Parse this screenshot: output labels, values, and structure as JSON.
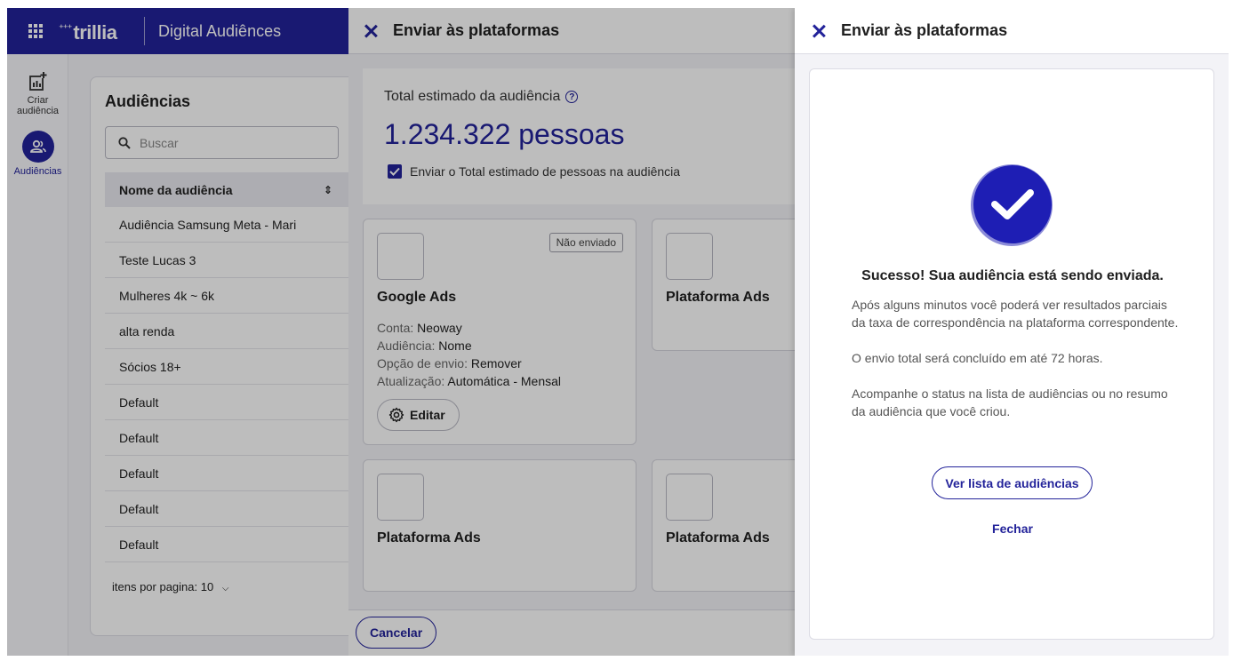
{
  "app": {
    "product_name": "Digital Audiênces",
    "brand_name": "trillia",
    "colors": {
      "brand": "#23239a",
      "background": "#f3f3f7"
    }
  },
  "nav": {
    "create": {
      "label_line1": "Criar",
      "label_line2": "audiência",
      "icon": "add-chart-icon"
    },
    "audiences": {
      "label": "Audiências",
      "icon": "group-icon"
    }
  },
  "audiences": {
    "title": "Audiências",
    "search_placeholder": "Buscar",
    "column_header": "Nome da audiência",
    "rows": [
      "Audiência Samsung Meta - Mari",
      "Teste Lucas 3",
      "Mulheres 4k ~ 6k",
      "alta renda",
      "Sócios 18+",
      "Default",
      "Default",
      "Default",
      "Default",
      "Default"
    ],
    "pager_label": "itens por pagina: 10"
  },
  "send_panel": {
    "title": "Enviar às plataformas",
    "total_label": "Total estimado da audiência",
    "total_value": "1.234.322 pessoas",
    "checkbox_label": "Enviar o Total estimado de pessoas na audiência",
    "platforms": [
      {
        "name": "Google Ads",
        "badge": "Não enviado",
        "fields": [
          {
            "label": "Conta:",
            "value": "Neoway"
          },
          {
            "label": "Audiência:",
            "value": "Nome"
          },
          {
            "label": "Opção de envio:",
            "value": "Remover"
          },
          {
            "label": "Atualização:",
            "value": "Automática - Mensal"
          }
        ],
        "edit_label": "Editar"
      },
      {
        "name": "Plataforma Ads"
      },
      {
        "name": "Plataforma Ads"
      },
      {
        "name": "Plataforma Ads"
      }
    ],
    "cancel_label": "Cancelar"
  },
  "success_panel": {
    "title": "Enviar às plataformas",
    "heading": "Sucesso! Sua audiência está sendo enviada.",
    "paragraphs": [
      "Após alguns minutos você poderá ver resultados parciais da taxa de correspondência na plataforma correspondente.",
      "O envio total será concluído em até 72 horas.",
      "Acompanhe o status na lista de audiências ou no resumo da audiência que você criou."
    ],
    "list_button": "Ver lista de audiências",
    "close_link": "Fechar"
  }
}
